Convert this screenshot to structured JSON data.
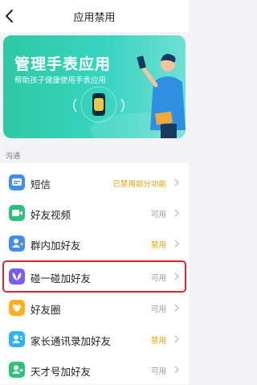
{
  "header": {
    "title": "应用禁用",
    "back_icon": "chevron-left-icon"
  },
  "banner": {
    "title": "管理手表应用",
    "subtitle": "帮助孩子健康使用手表应用",
    "illustration": "person-with-phone-and-watch"
  },
  "section": {
    "label": "沟通"
  },
  "items": [
    {
      "label": "短信",
      "status": "已禁用部分功能",
      "status_color": "#e6a400",
      "icon": "message-icon",
      "icon_color": "#3f8ef0"
    },
    {
      "label": "好友视频",
      "status": "可用",
      "status_color": "#9a9a9a",
      "icon": "video-camera-icon",
      "icon_color": "#2dc27a"
    },
    {
      "label": "群内加好友",
      "status": "禁用",
      "status_color": "#e6a400",
      "icon": "add-user-icon",
      "icon_color": "#3f8ef0"
    },
    {
      "label": "碰一碰加好友",
      "status": "可用",
      "status_color": "#9a9a9a",
      "icon": "butterfly-icon",
      "icon_color": "#7b5cf0"
    },
    {
      "label": "好友圈",
      "status": "可用",
      "status_color": "#9a9a9a",
      "icon": "heart-icon",
      "icon_color": "#ffb020"
    },
    {
      "label": "家长通讯录加好友",
      "status": "禁用",
      "status_color": "#e6a400",
      "icon": "contacts-icon",
      "icon_color": "#2bb5f5"
    },
    {
      "label": "天才号加好友",
      "status": "可用",
      "status_color": "#9a9a9a",
      "icon": "user-plus-icon",
      "icon_color": "#2dc27a"
    }
  ]
}
